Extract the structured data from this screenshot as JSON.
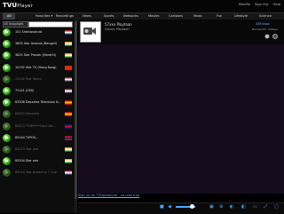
{
  "app": {
    "logo_tv": "TVU",
    "logo_player": "Player"
  },
  "user_links": [
    "Mimiflo",
    "Sign Out",
    "Help"
  ],
  "nav": {
    "tabs": [
      {
        "label": "All",
        "active": true
      },
      {
        "label": "Favorites ▾",
        "active": false
      },
      {
        "label": "Recordings",
        "active": false
      }
    ],
    "categories": [
      "News",
      "Sports",
      "Networks",
      "Movies",
      "Cartoons",
      "Music",
      "Fun",
      "Lifestyle",
      "Science"
    ]
  },
  "filters": {
    "language": "All languages",
    "search_value": ""
  },
  "channels": [
    {
      "name": "151 Sheklanaturd",
      "dim": false,
      "flag": "us"
    },
    {
      "name": "3805 Star Ananda (Bengali)",
      "dim": false,
      "flag": "in"
    },
    {
      "name": "3825 Star Pravah (Marathi)",
      "dim": false,
      "flag": "in"
    },
    {
      "name": "10192 Star TV (Hong Kong)",
      "dim": false,
      "flag": "hk"
    },
    {
      "name": "23202 Star World",
      "dim": true,
      "flag": "us"
    },
    {
      "name": "72141 (CBS)",
      "dim": false,
      "flag": "us"
    },
    {
      "name": "83508 Deportes Television N...",
      "dim": false,
      "flag": "es"
    },
    {
      "name": "84453 Deportes",
      "dim": true,
      "flag": "es"
    },
    {
      "name": "85423 **DEH***Stars Wa...",
      "dim": true,
      "flag": "gb"
    },
    {
      "name": "85244 TVPOS...",
      "dim": false,
      "flag": "th"
    },
    {
      "name": "85313 Star one",
      "dim": true,
      "flag": "in"
    },
    {
      "name": "85504 Star one",
      "dim": false,
      "flag": "in"
    },
    {
      "name": "85514 Star Academy 7 Live",
      "dim": true,
      "flag": "us"
    }
  ],
  "program": {
    "title": "57xxx Playtaan",
    "subtitle": "Classic Playtaan"
  },
  "stats": {
    "bitrate": "336 kbps",
    "buffer": "Bandwidth: 90kbps"
  },
  "signup_link": "Sign up for TVUpremium - no cost trial",
  "colors": {
    "accent": "#4fa6ff",
    "video_tint": "#5a2d73",
    "icon_green": "#36a61b"
  }
}
